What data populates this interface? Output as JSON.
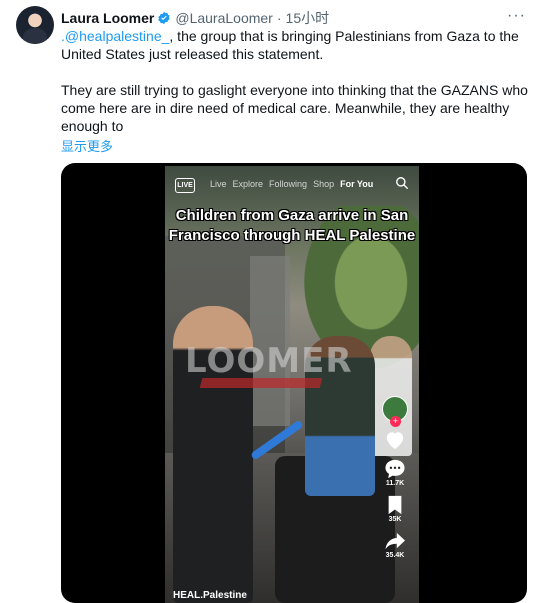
{
  "author": {
    "name": "Laura Loomer",
    "handle": "@LauraLoomer",
    "separator": "·",
    "time": "15小时",
    "verified_icon": "verified-badge-icon",
    "more_icon": "more-icon",
    "more_label": "···"
  },
  "tweet": {
    "mention": ".@healpalestine_",
    "line1_rest": ", the group that is bringing Palestinians from Gaza to the United States just released this statement.",
    "paragraph2": "They are still trying to gaslight everyone into thinking that the GAZANS who come here are in dire need of medical care. Meanwhile, they are healthy enough to",
    "show_more": "显示更多"
  },
  "video": {
    "live_label": "LIVE",
    "tabs": [
      "Live",
      "Explore",
      "Following",
      "Shop",
      "For You"
    ],
    "active_tab": "For You",
    "caption": "Children from Gaza arrive in San Francisco through HEAL Palestine",
    "watermark": "LOOMER",
    "username": "HEAL.Palestine",
    "actions": {
      "likes": "",
      "comments": "11.7K",
      "saves": "35K",
      "shares": "35.4K"
    }
  },
  "colors": {
    "accent": "#1d9bf0",
    "text": "#0f1419",
    "secondary": "#536471",
    "tiktok_red": "#fe2c55"
  }
}
